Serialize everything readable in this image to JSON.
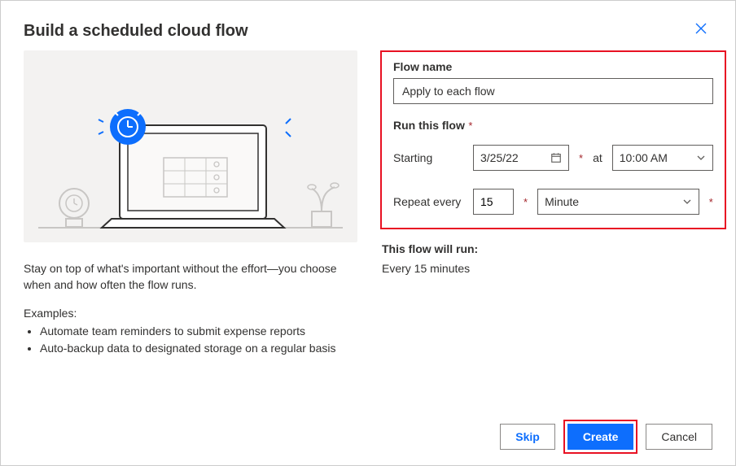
{
  "title": "Build a scheduled cloud flow",
  "left": {
    "desc": "Stay on top of what's important without the effort—you choose when and how often the flow runs.",
    "examplesHeading": "Examples:",
    "examples": [
      "Automate team reminders to submit expense reports",
      "Auto-backup data to designated storage on a regular basis"
    ]
  },
  "form": {
    "flowNameLabel": "Flow name",
    "flowNameValue": "Apply to each flow",
    "runThisFlowLabel": "Run this flow",
    "startingLabel": "Starting",
    "dateValue": "3/25/22",
    "atLabel": "at",
    "timeValue": "10:00 AM",
    "repeatEveryLabel": "Repeat every",
    "intervalValue": "15",
    "unitValue": "Minute"
  },
  "summary": {
    "heading": "This flow will run:",
    "text": "Every 15 minutes"
  },
  "buttons": {
    "skip": "Skip",
    "create": "Create",
    "cancel": "Cancel"
  }
}
